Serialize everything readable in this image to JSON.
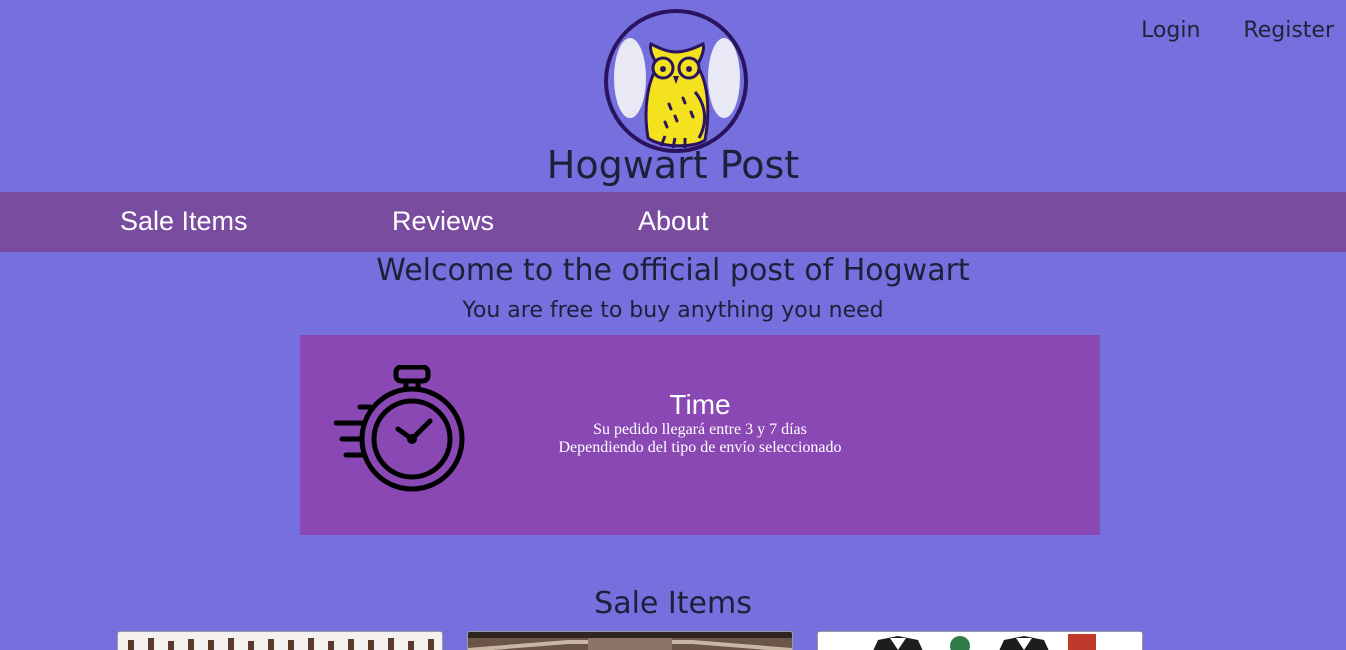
{
  "auth": {
    "login_label": "Login",
    "register_label": "Register"
  },
  "site": {
    "title": "Hogwart Post"
  },
  "nav": {
    "items": [
      {
        "label": "Sale Items"
      },
      {
        "label": "Reviews"
      },
      {
        "label": "About"
      }
    ]
  },
  "intro": {
    "heading": "Welcome to the official post of Hogwart",
    "tagline": "You are free to buy anything you need"
  },
  "time_card": {
    "icon": "stopwatch-icon",
    "title": "Time",
    "line1": "Su pedido llegará entre 3 y 7 días",
    "line2": "Dependiendo del tipo de envío seleccionado"
  },
  "sale": {
    "heading": "Sale Items",
    "products": [
      {
        "image": "wands-image"
      },
      {
        "image": "wood-image"
      },
      {
        "image": "uniforms-image"
      }
    ]
  },
  "colors": {
    "background": "#7670de",
    "navbar": "#794ca0",
    "card": "#8a48b5",
    "owl": "#f5e21f"
  }
}
